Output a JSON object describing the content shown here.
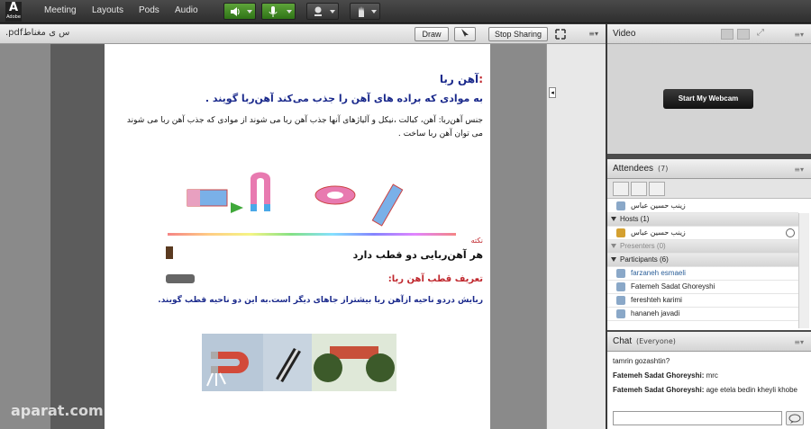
{
  "topbar": {
    "logo_text": "Adobe",
    "menus": [
      "Meeting",
      "Layouts",
      "Pods",
      "Audio"
    ]
  },
  "share": {
    "doc_title": ".pdfس ی مغناط",
    "draw_label": "Draw",
    "stop_sharing_label": "Stop Sharing"
  },
  "document": {
    "title": "آهن ربا",
    "title_colon": " :",
    "definition": "به موادی که براده های آهن را جذب می‌کند آهن‌ربا گویند .",
    "body": "جنس آهن‌ربا: آهن، کبالت ،نیکل و آلیاژهای آنها جذب آهن ربا می شوند از موادی که جذب آهن ربا می شوند می توان آهن ربا ساخت .",
    "note": "نکته",
    "two_poles": "هر آهن‌ربایی دو قطب دارد",
    "pole_definition_title": "تعریف قطب آهن ربا:",
    "pole_definition": "ربایش دردو ناحیه ازآهن ربا بیشتراز جاهای دیگر است.به این دو ناحیه قطب گویند."
  },
  "video": {
    "title": "Video",
    "webcam_label": "Start My Webcam"
  },
  "attendees": {
    "title": "Attendees",
    "count": "(7)",
    "self_name": "زینب حسین عباس",
    "hosts_label": "Hosts (1)",
    "host_name": "زینب حسین عباس",
    "presenters_label": "Presenters (0)",
    "participants_label": "Participants (6)",
    "participants": [
      "farzaneh esmaeli",
      "Fatemeh Sadat Ghoreyshi",
      "fereshteh karimi",
      "hananeh javadi"
    ]
  },
  "chat": {
    "title": "Chat",
    "scope": "(Everyone)",
    "messages": [
      {
        "sender": "",
        "text": "tamrin gozashtin?"
      },
      {
        "sender": "Fatemeh Sadat Ghoreyshi:",
        "text": " mrc"
      },
      {
        "sender": "Fatemeh Sadat Ghoreyshi:",
        "text": " age etela bedin kheyli khobe"
      }
    ]
  },
  "watermark": "aparat.com",
  "colors": {
    "accent_green": "#3f8a1f",
    "text_blue": "#1b2a8c",
    "text_red": "#c0282e"
  }
}
